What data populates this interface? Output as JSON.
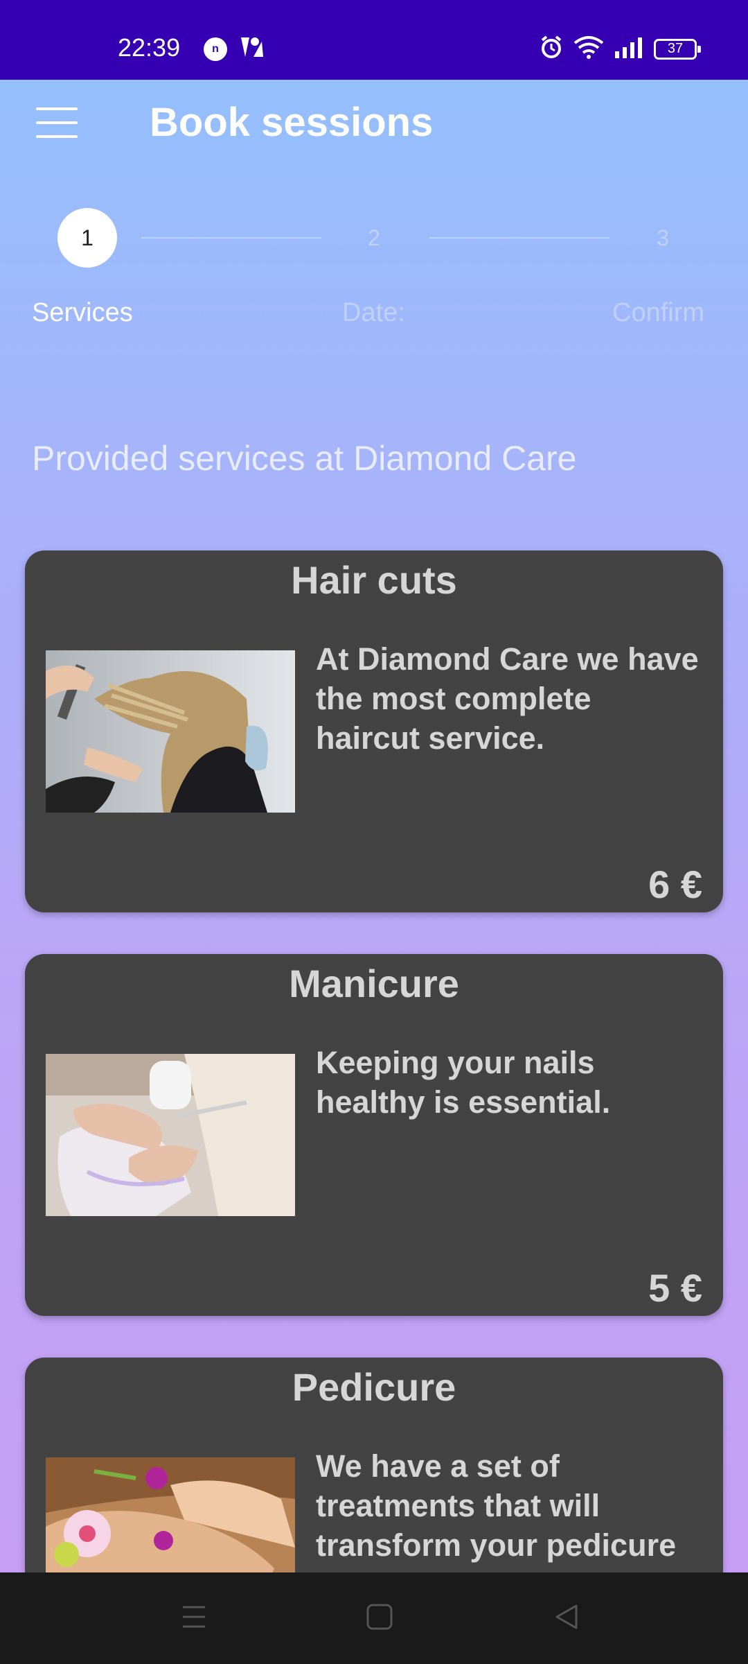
{
  "status_bar": {
    "time": "22:39",
    "notification_badge": "n",
    "battery": "37"
  },
  "app_bar": {
    "title": "Book sessions"
  },
  "stepper": {
    "steps": [
      {
        "number": "1",
        "label": "Services",
        "state": "active"
      },
      {
        "number": "2",
        "label": "Date:",
        "state": "inactive"
      },
      {
        "number": "3",
        "label": "Confirm",
        "state": "inactive"
      }
    ]
  },
  "section": {
    "heading": "Provided services at Diamond Care"
  },
  "services": [
    {
      "title": "Hair cuts",
      "description": "At Diamond Care we have the most complete haircut service.",
      "price": "6 €",
      "image_subject": "haircut-photo"
    },
    {
      "title": "Manicure",
      "description": "Keeping your nails healthy is essential.",
      "price": "5 €",
      "image_subject": "manicure-photo"
    },
    {
      "title": "Pedicure",
      "description": "We have a set of treatments that will transform your pedicure",
      "price": "",
      "image_subject": "pedicure-photo"
    }
  ],
  "colors": {
    "status_bar": "#3600b2",
    "card_bg": "#434343",
    "card_text": "#d6d6d6",
    "nav_bar": "#1a1a1a"
  }
}
